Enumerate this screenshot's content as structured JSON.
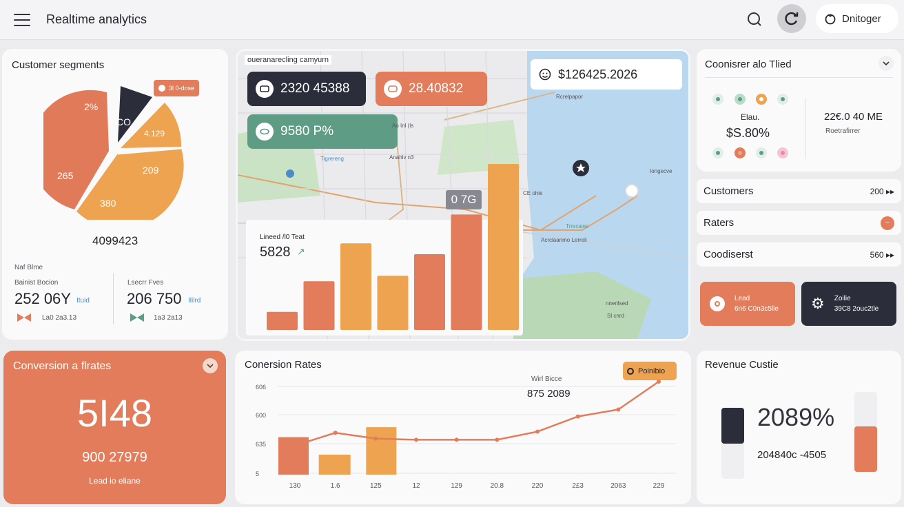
{
  "header": {
    "title": "Realtime analytics",
    "user_label": "Dnitoger"
  },
  "colors": {
    "orange": "#e27c5a",
    "amber": "#eda350",
    "navy": "#2b2d3a",
    "teal": "#5f9c85",
    "bg": "#ececee"
  },
  "segments": {
    "title": "Customer segments",
    "legend_badge": "3l 0-dose",
    "slices": [
      {
        "label": "2%",
        "value": 2
      },
      {
        "label": "CO",
        "value": 1
      },
      {
        "label": "4.129",
        "value": 1
      },
      {
        "label": "209",
        "value": 1
      },
      {
        "label": "380",
        "value": 1
      },
      {
        "label": "265",
        "value": 1
      }
    ],
    "total": "4099423",
    "caption": "Naf Blme",
    "stat1": {
      "label": "Bainist Bocion",
      "value": "252 06Y",
      "unit": "Ituid",
      "sub": "La0 2a3.13"
    },
    "stat2": {
      "label": "Lsecrr Fves",
      "value": "206 750",
      "unit": "Ililrd",
      "sub": "1a3 2a13"
    }
  },
  "map": {
    "title": "oueranarecling camyurn",
    "kpi_navy": "2320 45388",
    "kpi_orange": "28.40832",
    "kpi_teal": "9580 P%",
    "kpi_white": "$126425.2026",
    "badge": "0 7G",
    "bar_title": "Lineed /l0 Teat",
    "bar_value": "5828",
    "bars": [
      10,
      27,
      48,
      30,
      42,
      64,
      92
    ],
    "labels": [
      "Tigrereng",
      "Ao Inl (ls",
      "Anahlv n3",
      "Rcrelpapor",
      "Iongecve",
      "CE ohie",
      "Trrecaies",
      "Acrclaanmo Lerreli",
      "nnerilsed",
      "Sl cnrd"
    ]
  },
  "right_panel": {
    "title": "Coonisrer alo Tlied",
    "metric_label": "Elau.",
    "metric_value": "$S.80%",
    "side_value": "22€.0 40 ME",
    "side_sub": "Roetrafirrer"
  },
  "rows": [
    {
      "label": "Customers",
      "value": "200"
    },
    {
      "label": "Raters",
      "value": ""
    },
    {
      "label": "Coodiserst",
      "value": "560"
    }
  ],
  "tile_left": {
    "line1": "Lead",
    "line2": "6n6 C0n3c5lle"
  },
  "tile_right": {
    "line1": "Zoilie",
    "line2": "39C8 2ouc2tle"
  },
  "conversion": {
    "title": "Conversion a flrates",
    "value": "5I48",
    "sub": "900 27979",
    "footer": "Lead io eliane"
  },
  "chart_data": {
    "type": "line",
    "title": "Conersion Rates",
    "legend": "Poinibio",
    "annotation_label": "Wirl Bicce",
    "annotation_value": "875 2089",
    "y_ticks": [
      "606",
      "600",
      "635",
      "5"
    ],
    "categories": [
      "130",
      "1.6",
      "125",
      "12",
      "129",
      "20.8",
      "220",
      "2£3",
      "2063",
      "229"
    ],
    "bar_values": [
      300,
      160,
      380,
      null,
      null,
      null,
      null,
      null,
      null,
      null
    ],
    "line_values": [
      250,
      360,
      310,
      300,
      300,
      300,
      370,
      500,
      560,
      800
    ]
  },
  "revenue": {
    "title": "Revenue Custie",
    "value": "2089%",
    "sub": "204840c -4505",
    "levels": [
      0.42,
      0.18,
      0.55
    ]
  }
}
